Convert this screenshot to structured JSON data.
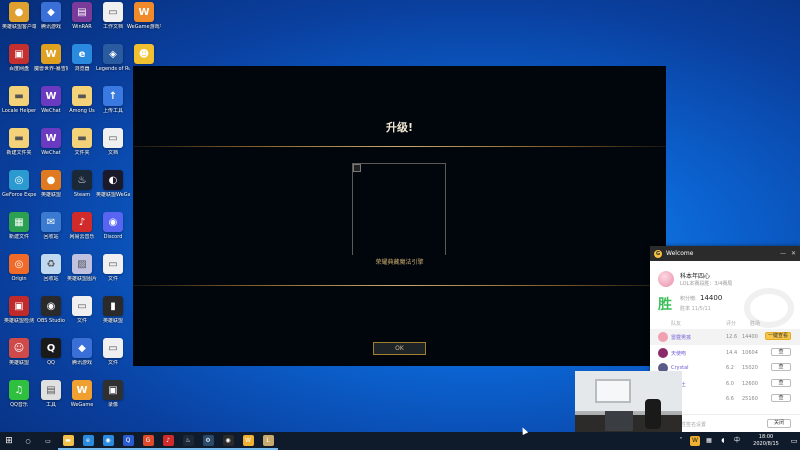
{
  "desktop": {
    "icons": [
      {
        "label": "英雄联盟客户端",
        "icon": "game-icon",
        "color": "#e0a030",
        "glyph": "●"
      },
      {
        "label": "腾讯游戏",
        "icon": "game-icon",
        "color": "#3a6fd8",
        "glyph": "◆"
      },
      {
        "label": "WinRAR",
        "icon": "archive-icon",
        "color": "#7a3a9a",
        "glyph": "▤"
      },
      {
        "label": "工作文档",
        "icon": "document-icon",
        "color": "#f0f0f0",
        "glyph": "▭"
      },
      {
        "label": "WeGame游戏平台",
        "icon": "wegame-icon",
        "color": "#f08a2a",
        "glyph": "W"
      },
      {
        "label": "百度网盘",
        "icon": "app-icon",
        "color": "#c43030",
        "glyph": "▣"
      },
      {
        "label": "魔兽世界-暴雪娱乐",
        "icon": "wow-icon",
        "color": "#e0a020",
        "glyph": "W"
      },
      {
        "label": "浏览器",
        "icon": "browser-icon",
        "color": "#2a8ae0",
        "glyph": "e"
      },
      {
        "label": "Legends of Runeterra",
        "icon": "runeterra-icon",
        "color": "#2a5aa0",
        "glyph": "◈"
      },
      {
        "label": "",
        "icon": "mascot-icon",
        "color": "#f0c030",
        "glyph": "☻"
      },
      {
        "label": "Locale Helper",
        "icon": "folder-icon",
        "color": "#f3d27a",
        "glyph": "▬"
      },
      {
        "label": "WeChat",
        "icon": "app-icon",
        "color": "#6a3ac0",
        "glyph": "W"
      },
      {
        "label": "Among Us",
        "icon": "folder-icon",
        "color": "#f3d27a",
        "glyph": "▬"
      },
      {
        "label": "上传工具",
        "icon": "app-icon",
        "color": "#3a7ae0",
        "glyph": "↑"
      },
      {
        "label": "新建文件夹",
        "icon": "folder-icon",
        "color": "#f3d27a",
        "glyph": "▬"
      },
      {
        "label": "WeChat",
        "icon": "app-icon",
        "color": "#6a3ac0",
        "glyph": "W"
      },
      {
        "label": "文件夹",
        "icon": "folder-icon",
        "color": "#f3d27a",
        "glyph": "▬"
      },
      {
        "label": "文档",
        "icon": "document-icon",
        "color": "#f0f0f0",
        "glyph": "▭"
      },
      {
        "label": "GeForce Experience",
        "icon": "app-icon",
        "color": "#2a9ad0",
        "glyph": "◎"
      },
      {
        "label": "英雄联盟",
        "icon": "game-icon",
        "color": "#e07a20",
        "glyph": "●"
      },
      {
        "label": "Steam",
        "icon": "steam-icon",
        "color": "#1b2838",
        "glyph": "♨"
      },
      {
        "label": "英雄联盟WeGame版",
        "icon": "game-icon",
        "color": "#1a1a2a",
        "glyph": "◐"
      },
      {
        "label": "新建文件",
        "icon": "app-icon",
        "color": "#2aa050",
        "glyph": "▦"
      },
      {
        "label": "回收站",
        "icon": "app-icon",
        "color": "#3a7ad0",
        "glyph": "✉"
      },
      {
        "label": "网易云音乐",
        "icon": "music-icon",
        "color": "#d02a2a",
        "glyph": "♪"
      },
      {
        "label": "Discord",
        "icon": "discord-icon",
        "color": "#5865f2",
        "glyph": "◉"
      },
      {
        "label": "Origin",
        "icon": "origin-icon",
        "color": "#f06a2a",
        "glyph": "◎"
      },
      {
        "label": "回收站",
        "icon": "recycle-bin-icon",
        "color": "#c0d8f0",
        "glyph": "♻"
      },
      {
        "label": "英雄联盟图片",
        "icon": "image-icon",
        "color": "#c0c0e0",
        "glyph": "▨"
      },
      {
        "label": "文件",
        "icon": "document-icon",
        "color": "#f0f0f0",
        "glyph": "▭"
      },
      {
        "label": "英雄联盟检测",
        "icon": "app-icon",
        "color": "#c02a2a",
        "glyph": "▣"
      },
      {
        "label": "OBS Studio",
        "icon": "obs-icon",
        "color": "#2a2a2a",
        "glyph": "◉"
      },
      {
        "label": "文件",
        "icon": "document-icon",
        "color": "#f0f0f0",
        "glyph": "▭"
      },
      {
        "label": "英雄联盟",
        "icon": "app-icon",
        "color": "#2a2a2a",
        "glyph": "▮"
      },
      {
        "label": "英雄联盟",
        "icon": "app-icon",
        "color": "#d04a4a",
        "glyph": "☺"
      },
      {
        "label": "QQ",
        "icon": "qq-icon",
        "color": "#1a1a1a",
        "glyph": "Q"
      },
      {
        "label": "腾讯游戏",
        "icon": "game-icon",
        "color": "#3a6fd8",
        "glyph": "◆"
      },
      {
        "label": "文件",
        "icon": "document-icon",
        "color": "#f0f0f0",
        "glyph": "▭"
      },
      {
        "label": "QQ音乐",
        "icon": "music-icon",
        "color": "#30c040",
        "glyph": "♫"
      },
      {
        "label": "工具",
        "icon": "app-icon",
        "color": "#e0e0e0",
        "glyph": "▤"
      },
      {
        "label": "WeGame",
        "icon": "wegame-icon",
        "color": "#f0a030",
        "glyph": "W"
      },
      {
        "label": "录像",
        "icon": "app-icon",
        "color": "#303030",
        "glyph": "▣"
      }
    ]
  },
  "game_window": {
    "title": "升级!",
    "reward_label": "荣耀典藏魔法引擎",
    "ok_label": "OK"
  },
  "welcome_panel": {
    "header_title": "Welcome",
    "header_logo": "G",
    "minimize": "—",
    "close": "✕",
    "profile": {
      "name": "科本年四心",
      "subtitle": "LOL本赛段胜：3/4赛局",
      "win_char": "胜",
      "score_label": "积分榜:",
      "score_value": "14400",
      "date_line": "胜率 11/5/11"
    },
    "table_header": {
      "col_rank": "队友",
      "col_level": "评分",
      "col_score": "胜场",
      "col_action": ""
    },
    "rows": [
      {
        "name": "雷霆男孩",
        "level": "12.6",
        "score": "14400",
        "action": "一键查看",
        "avatar": "#f0a0b0",
        "highlight": true
      },
      {
        "name": "天使吻",
        "level": "14.4",
        "score": "10604",
        "action": "查",
        "avatar": "#8a2a6a",
        "highlight": false
      },
      {
        "name": "Crystal",
        "level": "6.2",
        "score": "15020",
        "action": "查",
        "avatar": "#5a5a8a",
        "highlight": false
      },
      {
        "name": "小黑土",
        "level": "6.0",
        "score": "12600",
        "action": "查",
        "avatar": "#c09060",
        "highlight": false
      },
      {
        "name": "沃沃",
        "level": "6.6",
        "score": "25160",
        "action": "查",
        "avatar": "#d0b090",
        "highlight": false
      }
    ],
    "footer": {
      "hint": "个性签名设置",
      "ok": "关闭"
    }
  },
  "taskbar": {
    "start_glyph": "⊞",
    "apps": [
      {
        "name": "search",
        "color": "#0f1a2b",
        "glyph": "○"
      },
      {
        "name": "task-view",
        "color": "#0f1a2b",
        "glyph": "▭"
      },
      {
        "name": "explorer",
        "color": "#f3c04a",
        "glyph": "▬"
      },
      {
        "name": "edge",
        "color": "#2a8ae0",
        "glyph": "e"
      },
      {
        "name": "chrome",
        "color": "#2a8ae0",
        "glyph": "◉"
      },
      {
        "name": "qq",
        "color": "#2a5ad0",
        "glyph": "Q"
      },
      {
        "name": "garena",
        "color": "#e04a2a",
        "glyph": "G"
      },
      {
        "name": "netease-music",
        "color": "#d02a2a",
        "glyph": "♪"
      },
      {
        "name": "steam",
        "color": "#1b2838",
        "glyph": "♨"
      },
      {
        "name": "settings",
        "color": "#2a4a6a",
        "glyph": "⚙"
      },
      {
        "name": "obs",
        "color": "#2a2a2a",
        "glyph": "◉"
      },
      {
        "name": "wegame",
        "color": "#f0b030",
        "glyph": "W"
      },
      {
        "name": "league-client",
        "color": "#c8aa6e",
        "glyph": "L"
      }
    ],
    "clock_time": "18:00",
    "clock_date": "2020/8/15",
    "notification_glyph": "▭"
  }
}
